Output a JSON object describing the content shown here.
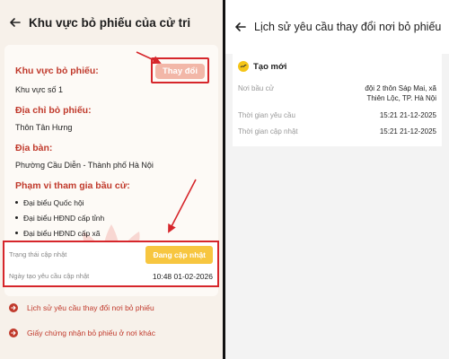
{
  "left": {
    "title": "Khu vực bỏ phiếu của cử tri",
    "card": {
      "zone_label": "Khu vực bỏ phiếu:",
      "change_button": "Thay đổi",
      "zone_value": "Khu vực số 1",
      "address_label": "Địa chỉ bỏ phiếu:",
      "address_value": "Thôn Tân Hưng",
      "area_label": "Địa bàn:",
      "area_value": "Phường Cầu Diễn - Thành phố Hà Nội",
      "scope_label": "Phạm vi tham gia bầu cử:",
      "scope_items": [
        "Đại biểu Quốc hội",
        "Đại biểu HĐND cấp tỉnh",
        "Đại biểu HĐND cấp xã"
      ]
    },
    "status": {
      "update_status_label": "Trạng thái cập nhật",
      "update_button": "Đang cập nhật",
      "request_date_label": "Ngày tạo yêu cầu cập nhật",
      "request_date_value": "10:48 01-02-2026"
    },
    "links": [
      {
        "label": "Lịch sử yêu cầu thay đổi nơi bỏ phiếu",
        "icon": "arrow-right-circle-icon"
      },
      {
        "label": "Giấy chứng nhận bỏ phiếu ở nơi khác",
        "icon": "arrow-right-circle-icon"
      }
    ]
  },
  "right": {
    "title": "Lịch sử yêu cầu thay đổi nơi bỏ phiếu",
    "entry": {
      "status": "Tạo mới",
      "residence_label": "Nơi bầu cử",
      "residence_value_line1": "đội 2 thôn Sáp Mai, xã",
      "residence_value_line2": "Thiên Lộc, TP. Hà Nội",
      "request_time_label": "Thời gian yêu cầu",
      "request_time_value": "15:21 21-12-2025",
      "update_time_label": "Thời gian cập nhật",
      "update_time_value": "15:21 21-12-2025"
    }
  },
  "colors": {
    "accent_red": "#c0392b",
    "annotation_red": "#d6262b",
    "update_button": "#f7c640",
    "change_button": "#f2b7a8",
    "status_icon": "#f5c518"
  }
}
